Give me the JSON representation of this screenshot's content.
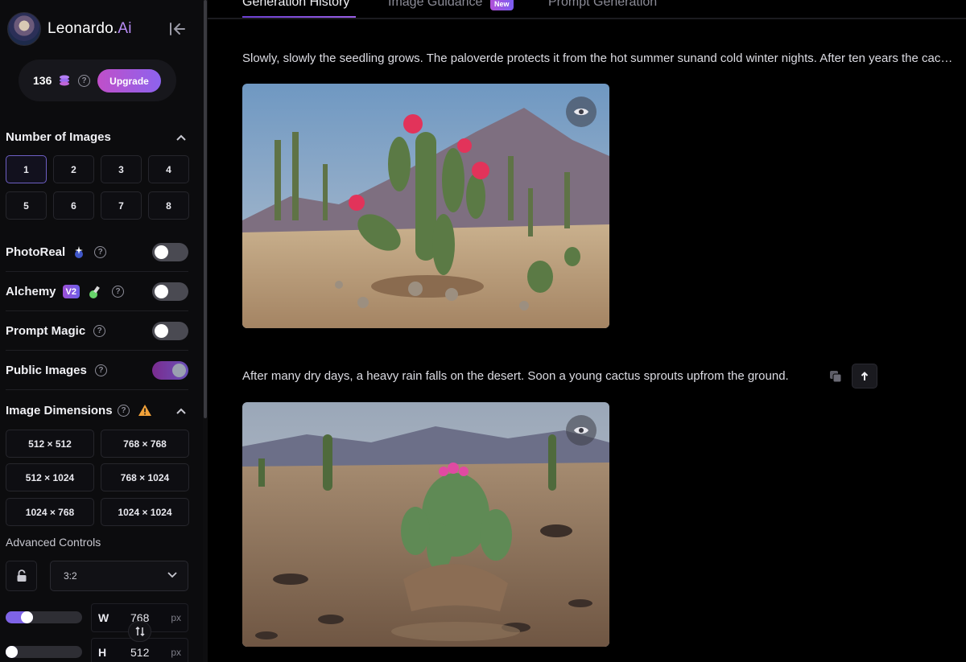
{
  "brand": {
    "name": "Leonardo.",
    "name_suffix": "Ai"
  },
  "credits": {
    "count": "136",
    "upgrade_label": "Upgrade"
  },
  "number_of_images": {
    "title": "Number of Images",
    "options": [
      "1",
      "2",
      "3",
      "4",
      "5",
      "6",
      "7",
      "8"
    ],
    "selected": "1"
  },
  "toggles": {
    "photoreal": {
      "label": "PhotoReal",
      "on": false
    },
    "alchemy": {
      "label": "Alchemy",
      "badge": "V2",
      "on": false
    },
    "prompt_magic": {
      "label": "Prompt Magic",
      "on": false
    },
    "public_images": {
      "label": "Public Images",
      "on": true
    }
  },
  "image_dimensions": {
    "title": "Image Dimensions",
    "options": [
      "512 × 512",
      "768 × 768",
      "512 × 1024",
      "768 × 1024",
      "1024 × 768",
      "1024 × 1024"
    ]
  },
  "advanced_controls": {
    "label": "Advanced Controls",
    "aspect_ratio": "3:2",
    "width": {
      "label": "W",
      "value": "768",
      "unit": "px",
      "slider_fraction": 0.24
    },
    "height": {
      "label": "H",
      "value": "512",
      "unit": "px",
      "slider_fraction": 0.0
    }
  },
  "tabs": [
    {
      "label": "Generation History",
      "active": true
    },
    {
      "label": "Image Guidance",
      "badge": "New"
    },
    {
      "label": "Prompt Generation"
    }
  ],
  "generations": [
    {
      "prompt": "Slowly, slowly the seedling grows. The paloverde protects it from the hot summer sunand cold winter nights. After ten years the cactus is only a few inches tall."
    },
    {
      "prompt": "After many dry days, a heavy rain falls on the desert. Soon a young cactus sprouts upfrom the ground."
    }
  ],
  "colors": {
    "accent": "#8d63ee",
    "background": "#000000",
    "sidebar": "#0c0c0e"
  },
  "icons": [
    "collapse-sidebar-icon",
    "coin-stack-icon",
    "help-icon",
    "chevron-up-icon",
    "sparkle-icon",
    "flask-icon",
    "warning-icon",
    "lock-icon",
    "chevron-down-icon",
    "swap-icon",
    "eye-icon",
    "copy-icon",
    "arrow-up-icon"
  ]
}
